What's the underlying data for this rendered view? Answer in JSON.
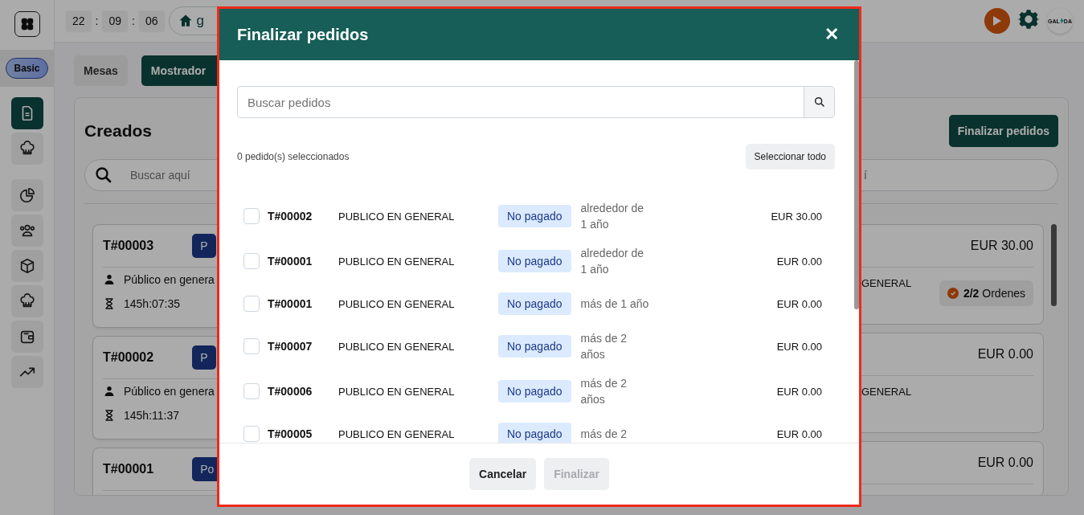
{
  "sidebar": {
    "plan_badge": "Basic",
    "items": [
      {
        "kind": "document",
        "selected": true
      },
      {
        "kind": "chef",
        "selected": false
      },
      {
        "kind": "chart",
        "selected": false
      },
      {
        "kind": "users",
        "selected": false
      },
      {
        "kind": "box",
        "selected": false
      },
      {
        "kind": "chef",
        "selected": false
      },
      {
        "kind": "wallet",
        "selected": false
      },
      {
        "kind": "trend",
        "selected": false
      }
    ]
  },
  "topbar": {
    "clock": {
      "hours": "22",
      "minutes": "09",
      "seconds": "06",
      "separators": [
        ":",
        ":"
      ]
    },
    "breadcrumb": "g",
    "logo": {
      "left": "GAL",
      "right": "DA"
    }
  },
  "tabs": [
    {
      "label": "Mesas",
      "selected": false
    },
    {
      "label": "Mostrador",
      "selected": true
    }
  ],
  "board": {
    "left_column": {
      "title": "Creados",
      "search": {
        "placeholder": "Buscar aquí"
      },
      "cards": [
        {
          "id": "T#00003",
          "badge": "P",
          "customer": "Público en genera",
          "timer": "145h:07:35"
        },
        {
          "id": "T#00002",
          "badge": "P",
          "customer": "Público en genera",
          "timer": "145h:11:37"
        },
        {
          "id": "T#00001",
          "badge": "Po"
        }
      ]
    },
    "right_column": {
      "action": "Finalizar pedidos",
      "search": {
        "placeholder": "í"
      },
      "cards": [
        {
          "amount": "EUR 30.00",
          "customer": "GENERAL",
          "orders": "**2/2** Ordenes"
        },
        {
          "amount": "EUR 0.00",
          "customer": "GENERAL"
        },
        {
          "amount": "EUR 0.00"
        }
      ]
    }
  },
  "dialog": {
    "title": "Finalizar pedidos",
    "close": "✕",
    "search": {
      "placeholder": "Buscar pedidos"
    },
    "selection_count": "0 pedido(s) seleccionados",
    "select_all": "Seleccionar todo",
    "orders": [
      {
        "id": "T#00002",
        "customer": "PUBLICO EN GENERAL",
        "status": "No pagado",
        "age": "alrededor de 1 año",
        "amount": "EUR 30.00",
        "checked": false
      },
      {
        "id": "T#00001",
        "customer": "PUBLICO EN GENERAL",
        "status": "No pagado",
        "age": "alrededor de 1 año",
        "amount": "EUR 0.00",
        "checked": false
      },
      {
        "id": "T#00001",
        "customer": "PUBLICO EN GENERAL",
        "status": "No pagado",
        "age": "más de 1 año",
        "amount": "EUR 0.00",
        "checked": false
      },
      {
        "id": "T#00007",
        "customer": "PUBLICO EN GENERAL",
        "status": "No pagado",
        "age": "más de 2 años",
        "amount": "EUR 0.00",
        "checked": false
      },
      {
        "id": "T#00006",
        "customer": "PUBLICO EN GENERAL",
        "status": "No pagado",
        "age": "más de 2 años",
        "amount": "EUR 0.00",
        "checked": false
      },
      {
        "id": "T#00005",
        "customer": "PUBLICO EN GENERAL",
        "status": "No pagado",
        "age": "más de 2",
        "amount": "EUR 0.00",
        "checked": false
      }
    ],
    "buttons": [
      {
        "label": "Cancelar",
        "disabled": false
      },
      {
        "label": "Finalizar",
        "disabled": true
      }
    ]
  }
}
